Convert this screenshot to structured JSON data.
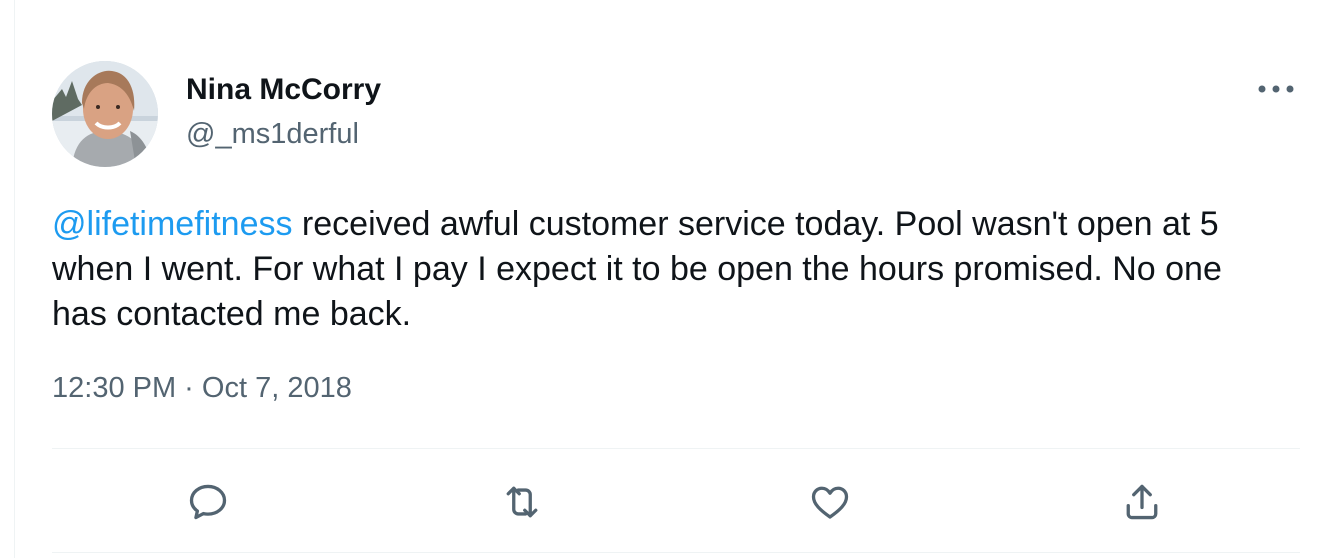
{
  "tweet": {
    "author": {
      "display_name": "Nina McCorry",
      "handle": "@_ms1derful"
    },
    "text": {
      "mention": "@lifetimefitness",
      "body": " received awful customer service today. Pool wasn't open at 5 when I went. For what I pay I expect it to be open the hours promised. No one has contacted me back."
    },
    "timestamp": "12:30 PM · Oct 7, 2018"
  },
  "actions": [
    {
      "icon": "reply-icon"
    },
    {
      "icon": "retweet-icon"
    },
    {
      "icon": "like-icon"
    },
    {
      "icon": "share-icon"
    }
  ],
  "colors": {
    "link": "#1d9bf0",
    "secondary_text": "#536471",
    "primary_text": "#0f1419",
    "divider": "#eff3f4"
  }
}
